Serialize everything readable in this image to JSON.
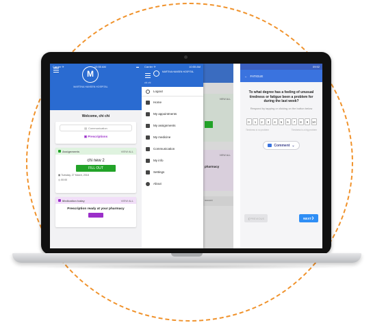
{
  "phone1": {
    "status_left": "Carrier ✈",
    "status_time": "10:55 AM",
    "logo_letter": "M",
    "hospital_name": "MARTINA HANSEN HOSPITAL",
    "welcome": "Welcome, chi chi",
    "communication": "Communication",
    "prescriptions": "Prescriptions",
    "assignments_title": "Assignments",
    "view_all": "VIEW ALL",
    "assignment_name": "chi new 2",
    "fill_out": "FILL OUT",
    "assignment_date": "Tuesday, 27 March, 2018",
    "assignment_time": "00:00",
    "medication_title": "Medication today",
    "medication_text": "Prescription ready at your pharmacy"
  },
  "phone2": {
    "status_left": "Carrier ✈",
    "status_time": "10:55 AM",
    "drawer_title": "MARTINA HANSEN HOSPITAL",
    "drawer_sub": "chi chi",
    "menu": [
      "Logout",
      "Home",
      "My appointments",
      "My assignments",
      "My medicine",
      "Communication",
      "My info",
      "Settings",
      "About"
    ],
    "bg_view_all_1": "VIEW ALL",
    "bg_view_all_2": "VIEW ALL",
    "bg_pharmacy": "pharmacy",
    "bg_comment": "mment"
  },
  "phone3": {
    "status_time": "09:52",
    "screen_title": "FATIGUE",
    "question": "To what degree has a feeling of unusual tiredness or fatigue been a problem for during the last week?",
    "instructions": "Respond by tapping or clicking on the button below",
    "scale": [
      "0",
      "1",
      "2",
      "3",
      "4",
      "5",
      "6",
      "7",
      "8",
      "9",
      "10"
    ],
    "scale_low": "Tiredness is no problem",
    "scale_high": "Tiredness is a big problem",
    "comment_label": "Comment",
    "previous_label": "PREVIOUS",
    "next_label": "NEXT"
  },
  "colors": {
    "brand_blue": "#2a6bd1",
    "accent_orange": "#f0922b",
    "fill_green": "#22a328",
    "prescription_purple": "#9b2fc9",
    "next_blue": "#2f8ef5"
  }
}
